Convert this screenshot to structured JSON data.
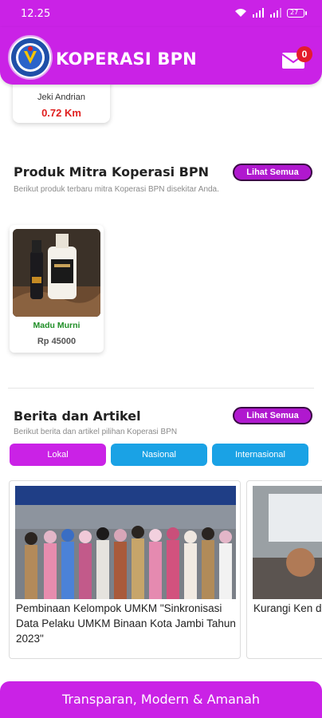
{
  "status_bar": {
    "time": "12.25",
    "battery": "27"
  },
  "app_bar": {
    "title": "KOPERASI BPN",
    "mail_badge": "0"
  },
  "driver": {
    "name": "Jeki Andrian",
    "distance": "0.72 Km"
  },
  "produk": {
    "title": "Produk Mitra Koperasi BPN",
    "subtitle": "Berikut produk terbaru mitra Koperasi BPN disekitar Anda.",
    "see_all": "Lihat Semua",
    "items": [
      {
        "name": "Madu Murni",
        "price": "Rp 45000"
      }
    ]
  },
  "berita": {
    "title": "Berita dan Artikel",
    "subtitle": "Berikut berita dan artikel pilihan Koperasi BPN",
    "see_all": "Lihat Semua",
    "tabs": [
      {
        "label": "Lokal",
        "active": true
      },
      {
        "label": "Nasional",
        "active": false
      },
      {
        "label": "Internasional",
        "active": false
      }
    ],
    "articles": [
      {
        "title": "Pembinaan Kelompok UMKM \"Sinkronisasi Data Pelaku UMKM Binaan Kota Jambi Tahun 2023\""
      },
      {
        "title": "Kurangi Ken di Jambi, Sa Rekayasa"
      }
    ]
  },
  "footer": {
    "tagline": "Transparan, Modern & Amanah"
  },
  "colors": {
    "primary": "#ca22e6",
    "secondary": "#1aa2e5",
    "price_red": "#e01e1e",
    "product_green": "#1f8e26"
  }
}
